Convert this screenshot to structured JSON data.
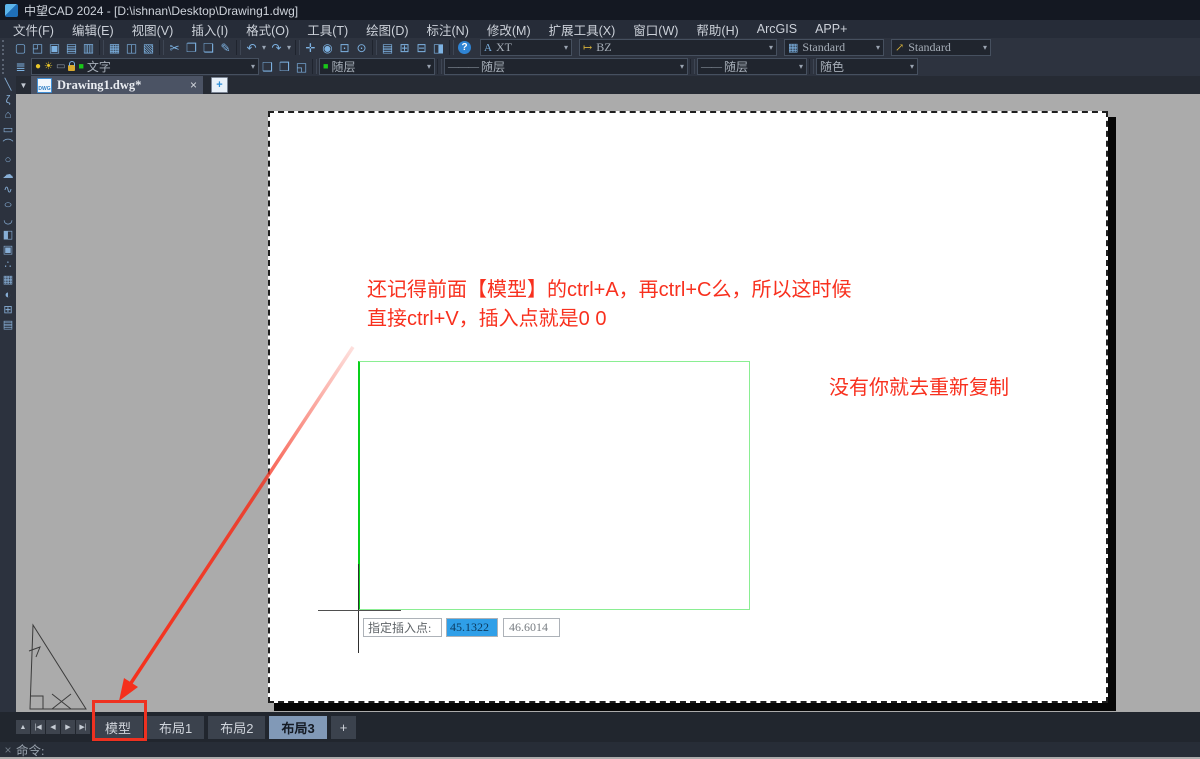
{
  "window": {
    "title": "中望CAD 2024 - [D:\\ishnan\\Desktop\\Drawing1.dwg]"
  },
  "ui": {
    "caret": "▾",
    "doc_caret": "▼",
    "close": "×",
    "plus": "+",
    "dwg_badge": "DWG"
  },
  "menu_bar": {
    "items": [
      "文件(F)",
      "编辑(E)",
      "视图(V)",
      "插入(I)",
      "格式(O)",
      "工具(T)",
      "绘图(D)",
      "标注(N)",
      "修改(M)",
      "扩展工具(X)",
      "窗口(W)",
      "帮助(H)",
      "ArcGIS",
      "APP+"
    ]
  },
  "toolbar1": {
    "items": [
      {
        "n": "toolbar-grip",
        "g": "",
        "c": "tgrip",
        "i": "true"
      },
      {
        "n": "new-icon",
        "g": "▢",
        "c": "tbi",
        "i": "true"
      },
      {
        "n": "open-icon",
        "g": "◰",
        "c": "tbi",
        "i": "true"
      },
      {
        "n": "save-icon",
        "g": "▣",
        "c": "tbi",
        "i": "true"
      },
      {
        "n": "save-as-icon",
        "g": "▤",
        "c": "tbi",
        "i": "true"
      },
      {
        "n": "save-all-icon",
        "g": "▥",
        "c": "tbi",
        "i": "true"
      },
      {
        "n": "separator",
        "g": "",
        "c": "tsep",
        "i": "false"
      },
      {
        "n": "plot-icon",
        "g": "▦",
        "c": "tbi",
        "i": "true"
      },
      {
        "n": "plot-preview-icon",
        "g": "◫",
        "c": "tbi",
        "i": "true"
      },
      {
        "n": "publish-icon",
        "g": "▧",
        "c": "tbi",
        "i": "true"
      },
      {
        "n": "separator",
        "g": "",
        "c": "tsep",
        "i": "false"
      },
      {
        "n": "cut-icon",
        "g": "✂",
        "c": "tbi",
        "i": "true"
      },
      {
        "n": "copy-icon",
        "g": "❐",
        "c": "tbi",
        "i": "true"
      },
      {
        "n": "paste-icon",
        "g": "❏",
        "c": "tbi",
        "i": "true"
      },
      {
        "n": "match-properties-icon",
        "g": "✎",
        "c": "tbi",
        "i": "true"
      },
      {
        "n": "separator",
        "g": "",
        "c": "tsep",
        "i": "false"
      },
      {
        "n": "undo-icon",
        "g": "↶",
        "c": "tbi",
        "i": "true"
      },
      {
        "n": "undo-dropdown-icon",
        "g": "▾",
        "c": "tbi tiny",
        "i": "true"
      },
      {
        "n": "redo-icon",
        "g": "↷",
        "c": "tbi",
        "i": "true"
      },
      {
        "n": "redo-dropdown-icon",
        "g": "▾",
        "c": "tbi tiny",
        "i": "true"
      },
      {
        "n": "separator",
        "g": "",
        "c": "tsep",
        "i": "false"
      },
      {
        "n": "pan-icon",
        "g": "✛",
        "c": "tbi",
        "i": "true"
      },
      {
        "n": "zoom-realtime-icon",
        "g": "◉",
        "c": "tbi",
        "i": "true"
      },
      {
        "n": "zoom-window-icon",
        "g": "⊡",
        "c": "tbi",
        "i": "true"
      },
      {
        "n": "zoom-previous-icon",
        "g": "⊙",
        "c": "tbi",
        "i": "true"
      },
      {
        "n": "separator",
        "g": "",
        "c": "tsep",
        "i": "false"
      },
      {
        "n": "properties-palette-icon",
        "g": "▤",
        "c": "tbi",
        "i": "true"
      },
      {
        "n": "design-center-icon",
        "g": "⊞",
        "c": "tbi",
        "i": "true"
      },
      {
        "n": "tool-palettes-icon",
        "g": "⊟",
        "c": "tbi",
        "i": "true"
      },
      {
        "n": "sheet-set-icon",
        "g": "◨",
        "c": "tbi",
        "i": "true"
      },
      {
        "n": "separator",
        "g": "",
        "c": "tsep",
        "i": "false"
      },
      {
        "n": "help-icon",
        "g": "?",
        "c": "tbi help",
        "i": "true"
      }
    ],
    "style_icons": {
      "text": "A",
      "dim": "↦",
      "table": "▦",
      "mleader": "↗"
    },
    "text_style": "XT",
    "dim_style": "BZ",
    "table_style": "Standard",
    "mleader_style": "Standard"
  },
  "toolbar2": {
    "icons": {
      "layer_props": "≣",
      "bulb": "●",
      "freeze": "☀",
      "vp": "▭",
      "chip": "■",
      "make_current": "❑",
      "layer_prev": "❒",
      "layer_states": "◱"
    },
    "layer_name": "文字",
    "color": "随层",
    "linetype_dash": "———",
    "linetype": "随层",
    "lineweight_dash": "——",
    "lineweight": "随层",
    "plot_style": "随色"
  },
  "doc_tab_bar": {
    "active_tab": "Drawing1.dwg*"
  },
  "draw_toolbar": {
    "items": [
      {
        "n": "line-icon",
        "g": "╲"
      },
      {
        "n": "polyline-icon",
        "g": "ζ"
      },
      {
        "n": "polygon-icon",
        "g": "⌂"
      },
      {
        "n": "rectangle-icon",
        "g": "▭"
      },
      {
        "n": "arc-icon",
        "g": "⌒"
      },
      {
        "n": "circle-icon",
        "g": "○"
      },
      {
        "n": "revcloud-icon",
        "g": "☁"
      },
      {
        "n": "spline-icon",
        "g": "∿"
      },
      {
        "n": "ellipse-icon",
        "g": "○"
      },
      {
        "n": "ellipse-arc-icon",
        "g": "◡"
      },
      {
        "n": "insert-block-icon",
        "g": "◧"
      },
      {
        "n": "create-block-icon",
        "g": "▣"
      },
      {
        "n": "point-icon",
        "g": "∴"
      },
      {
        "n": "hatch-icon",
        "g": "▦"
      },
      {
        "n": "gradient-icon",
        "g": "◐"
      },
      {
        "n": "table-icon",
        "g": "⊞"
      },
      {
        "n": "image-icon",
        "g": "▤"
      }
    ]
  },
  "canvas": {
    "annotations": {
      "line1": "还记得前面【模型】的ctrl+A，再ctrl+C么，所以这时候",
      "line2": "直接ctrl+V，插入点就是0 0",
      "note": "没有你就去重新复制"
    },
    "dynamic_input": {
      "label": "指定插入点:",
      "x_value": "45.1322",
      "y_value": "46.6014"
    }
  },
  "layout_bar": {
    "nav": [
      {
        "g": "▲",
        "n": "layout-nav-up-icon"
      },
      {
        "g": "|◀",
        "n": "layout-nav-first-icon"
      },
      {
        "g": "◀",
        "n": "layout-nav-prev-icon"
      },
      {
        "g": "▶",
        "n": "layout-nav-next-icon"
      },
      {
        "g": "▶|",
        "n": "layout-nav-last-icon"
      }
    ],
    "tabs": [
      {
        "label": "模型",
        "c": "ltab",
        "n": "tab-model"
      },
      {
        "label": "布局1",
        "c": "ltab",
        "n": "tab-layout1"
      },
      {
        "label": "布局2",
        "c": "ltab",
        "n": "tab-layout2"
      },
      {
        "label": "布局3",
        "c": "ltab active",
        "n": "tab-layout3"
      }
    ],
    "add_label": "+"
  },
  "command_bar": {
    "close_icon": "×",
    "prompt": "命令:"
  },
  "colors": {
    "accent_red": "#ee3120",
    "viewport_green": "#09d01b",
    "selection_blue": "#2f9fe8",
    "active_tab_blue": "#8199b7",
    "canvas_gray": "#ababab"
  }
}
